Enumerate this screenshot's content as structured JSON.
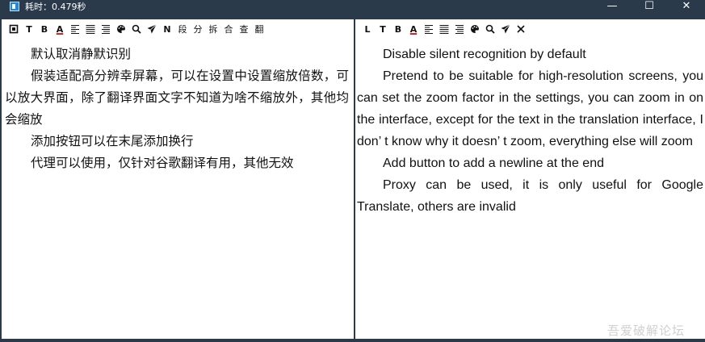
{
  "window": {
    "title": "耗时：0.479秒",
    "minimize_glyph": "—",
    "maximize_glyph": "☐",
    "close_glyph": "✕"
  },
  "left_toolbar": [
    {
      "name": "square-icon",
      "glyph": "□"
    },
    {
      "name": "text-t-button",
      "label": "T"
    },
    {
      "name": "bold-button",
      "label": "B"
    },
    {
      "name": "font-color-button",
      "label": "A"
    },
    {
      "name": "align-left-icon",
      "glyph": "≡"
    },
    {
      "name": "align-justify-icon",
      "glyph": "☰"
    },
    {
      "name": "align-right-icon",
      "glyph": "☰"
    },
    {
      "name": "palette-icon",
      "glyph": "◕"
    },
    {
      "name": "search-icon",
      "glyph": "⌕"
    },
    {
      "name": "send-icon",
      "glyph": "➤"
    },
    {
      "name": "n-button",
      "label": "N"
    },
    {
      "name": "duan-button",
      "label": "段"
    },
    {
      "name": "fen-button",
      "label": "分"
    },
    {
      "name": "chai-button",
      "label": "拆"
    },
    {
      "name": "he-button",
      "label": "合"
    },
    {
      "name": "cha-button",
      "label": "查"
    },
    {
      "name": "fan-button",
      "label": "翻"
    }
  ],
  "right_toolbar": [
    {
      "name": "l-button",
      "label": "L"
    },
    {
      "name": "text-t-button",
      "label": "T"
    },
    {
      "name": "bold-button",
      "label": "B"
    },
    {
      "name": "font-color-button",
      "label": "A"
    },
    {
      "name": "align-left-icon",
      "glyph": "≡"
    },
    {
      "name": "align-justify-icon",
      "glyph": "☰"
    },
    {
      "name": "align-right-icon",
      "glyph": "☰"
    },
    {
      "name": "palette-icon",
      "glyph": "◕"
    },
    {
      "name": "search-icon",
      "glyph": "⌕"
    },
    {
      "name": "send-icon",
      "glyph": "➤"
    },
    {
      "name": "close-icon",
      "glyph": "✕"
    }
  ],
  "source_text": [
    "默认取消静默识别",
    "假装适配高分辨幸屏幕，可以在设置中设置缩放倍数，可以放大界面，除了翻译界面文字不知道为啥不缩放外，其他均会缩放",
    "添加按钮可以在末尾添加换行",
    "代理可以使用，仅针对谷歌翻译有用，其他无效"
  ],
  "translated_text": [
    "Disable silent recognition by default",
    "Pretend to be suitable for high-resolution screens, you can set the zoom factor in the settings, you can zoom in on the interface, except for the text in the translation interface, I don’ t know why it doesn’ t zoom, everything else will zoom",
    "Add button to add a newline at the end",
    "Proxy can be used, it is only useful for Google Translate, others are invalid"
  ],
  "watermark": "吾爱破解论坛",
  "colors": {
    "titlebar_bg": "#2b3a4a",
    "pane_bg": "#ffffff",
    "font_color_underline": "#e02020",
    "app_icon": "#1e88e5"
  }
}
